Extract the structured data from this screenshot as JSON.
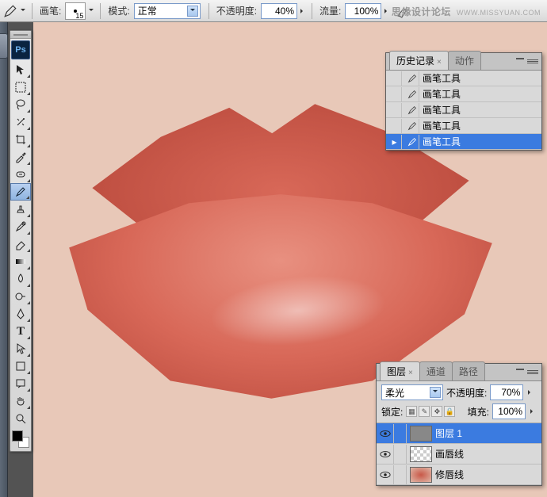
{
  "watermark": {
    "site": "思缘设计论坛",
    "url": "WWW.MISSYUAN.COM"
  },
  "options": {
    "brush_label": "画笔:",
    "brush_size": "15",
    "mode_label": "模式:",
    "mode_value": "正常",
    "opacity_label": "不透明度:",
    "opacity_value": "40%",
    "flow_label": "流量:",
    "flow_value": "100%"
  },
  "toolbox": {
    "logo": "Ps"
  },
  "history": {
    "tab_history": "历史记录",
    "tab_actions": "动作",
    "rows": [
      "画笔工具",
      "画笔工具",
      "画笔工具",
      "画笔工具",
      "画笔工具"
    ]
  },
  "layers": {
    "tab_layers": "图层",
    "tab_channels": "通道",
    "tab_paths": "路径",
    "blend_value": "柔光",
    "opacity_label": "不透明度:",
    "opacity_value": "70%",
    "lock_label": "锁定:",
    "fill_label": "填充:",
    "fill_value": "100%",
    "items": [
      {
        "name": "图层 1"
      },
      {
        "name": "画唇线"
      },
      {
        "name": "修唇线"
      }
    ]
  }
}
